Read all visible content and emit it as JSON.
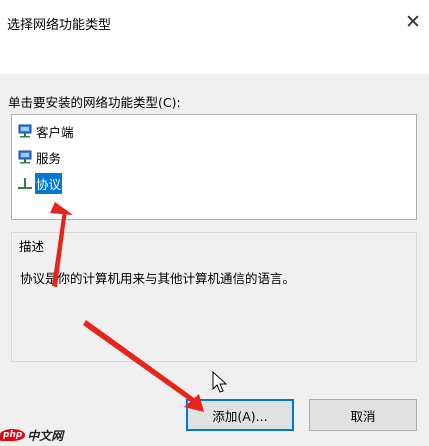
{
  "window": {
    "title": "选择网络功能类型",
    "close_glyph": "✕"
  },
  "prompt": "单击要安装的网络功能类型(C):",
  "list_items": [
    {
      "label": "客户端",
      "icon": "network-client-icon",
      "selected": false
    },
    {
      "label": "服务",
      "icon": "network-service-icon",
      "selected": false
    },
    {
      "label": "协议",
      "icon": "protocol-icon",
      "selected": true
    }
  ],
  "description": {
    "group_title": "描述",
    "text": "协议是你的计算机用来与其他计算机通信的语言。"
  },
  "buttons": {
    "add": "添加(A)...",
    "cancel": "取消"
  },
  "watermark": {
    "php": "php",
    "site": "中文网"
  },
  "colors": {
    "selection": "#0078d7",
    "annotation_arrow": "#e8231a",
    "dialog_bg": "#f0f0f0"
  }
}
